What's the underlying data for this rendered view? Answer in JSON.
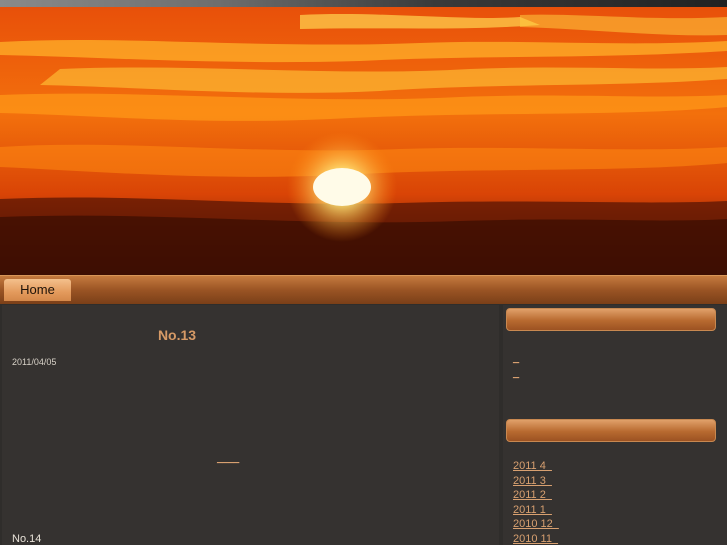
{
  "nav": {
    "items": [
      {
        "label": "Home"
      }
    ]
  },
  "post": {
    "title": "No.13",
    "date": "2011/04/05",
    "more_link": "____"
  },
  "next_post": {
    "title": "No.14"
  },
  "sidebar": {
    "widget1": {
      "links": [
        "_",
        "_"
      ]
    },
    "archives": {
      "links": [
        "2011 4  ",
        "2011 3  ",
        "2011 2  ",
        "2011 1  ",
        "2010 12  ",
        "2010 11  "
      ]
    }
  },
  "colors": {
    "accent": "#d69a66",
    "link": "#d8a070",
    "background": "#353230",
    "nav": "#9a5424"
  }
}
